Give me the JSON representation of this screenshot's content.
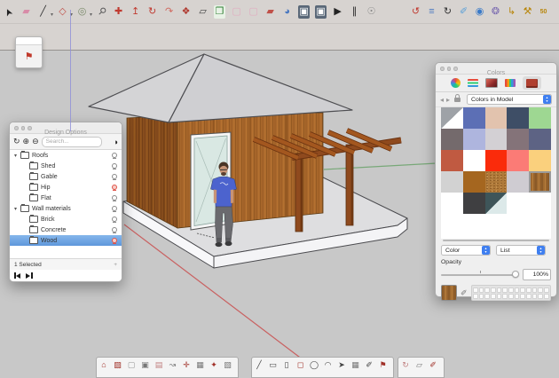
{
  "top_toolbar": {
    "icons_left": [
      {
        "n": "select",
        "g": "➤",
        "c": "#222222",
        "r": -115
      },
      {
        "n": "eraser",
        "g": "▰",
        "c": "#D88CA8"
      },
      {
        "n": "line",
        "g": "╱",
        "c": "#333333",
        "sub": true
      },
      {
        "n": "shape",
        "g": "◇",
        "c": "#C05048",
        "sub": true
      },
      {
        "n": "circle",
        "g": "◎",
        "c": "#7A8A6A",
        "sub": true
      },
      {
        "n": "zoom",
        "g": "⚲",
        "c": "#555555",
        "r": 45
      },
      {
        "n": "move",
        "g": "✚",
        "c": "#C03A30"
      },
      {
        "n": "push-pull",
        "g": "↥",
        "c": "#C03A30"
      },
      {
        "n": "rotate",
        "g": "↻",
        "c": "#C03A30"
      },
      {
        "n": "offset",
        "g": "↷",
        "c": "#D06A60"
      },
      {
        "n": "follow-me",
        "g": "❖",
        "c": "#B03A30"
      },
      {
        "n": "eraser-soft",
        "g": "▱",
        "c": "#444444"
      },
      {
        "n": "make-component",
        "g": "❐",
        "c": "#2E7D32",
        "bg": "#E8F2E6"
      },
      {
        "n": "paint-bucket",
        "g": "▢",
        "c": "#E0AEC0"
      },
      {
        "n": "texture",
        "g": "▢",
        "c": "#E0AEC0"
      },
      {
        "n": "section-plane",
        "g": "▰",
        "c": "#C05048"
      },
      {
        "n": "orbit",
        "g": "◕",
        "c": "#4A78C0"
      },
      {
        "n": "pan",
        "g": "▣",
        "c": "#FFFFFF",
        "bg": "#5A6878"
      },
      {
        "n": "zoom-extents",
        "g": "▣",
        "c": "#FFFFFF",
        "bg": "#5A6878"
      },
      {
        "n": "play",
        "g": "▶",
        "c": "#222222"
      },
      {
        "n": "pause",
        "g": "∥",
        "c": "#222222"
      },
      {
        "n": "user-account",
        "g": "☉",
        "c": "#888888"
      }
    ],
    "icons_right": [
      {
        "n": "redo-history",
        "g": "↺",
        "c": "#C03A30"
      },
      {
        "n": "entity-list",
        "g": "≡",
        "c": "#4A78C0"
      },
      {
        "n": "sync",
        "g": "↻",
        "c": "#333333"
      },
      {
        "n": "style-brush",
        "g": "✐",
        "c": "#5AA0D8"
      },
      {
        "n": "visibility-eye",
        "g": "◉",
        "c": "#3A7AC8"
      },
      {
        "n": "orbit-model",
        "g": "❂",
        "c": "#7A6AB0"
      },
      {
        "n": "pipe-tool",
        "g": "↳",
        "c": "#B8860B"
      },
      {
        "n": "hammer-tool",
        "g": "⚒",
        "c": "#B8860B"
      },
      {
        "n": "fifty-fifty",
        "g": "50",
        "c": "#B8860B",
        "txt": true
      }
    ]
  },
  "mini_palette": {
    "icon_glyph": "⚑"
  },
  "design_options": {
    "title": "Design Options",
    "search_placeholder": "Search...",
    "icons": {
      "refresh": "↻",
      "add": "⊕",
      "remove": "⊖",
      "toggle": "◑"
    },
    "tree": [
      {
        "label": "Roofs"
      },
      {
        "label": "Shed"
      },
      {
        "label": "Gable"
      },
      {
        "label": "Hip"
      },
      {
        "label": "Flat"
      },
      {
        "label": "Wall materials"
      },
      {
        "label": "Brick"
      },
      {
        "label": "Concrete"
      },
      {
        "label": "Wood"
      }
    ],
    "status": "1 Selected",
    "plus": "+"
  },
  "colors_panel": {
    "title": "Colors",
    "nav": {
      "back": "◂",
      "forward": "▸"
    },
    "dropdown_value": "Colors in Model",
    "color_label": "Color",
    "list_label": "List",
    "opacity_label": "Opacity",
    "opacity_value": "100%",
    "swatches": [
      {
        "t": "default"
      },
      {
        "c": "#5C6FB5"
      },
      {
        "c": "#E2C3AE"
      },
      {
        "c": "#3E4E66"
      },
      {
        "c": "#9ED792"
      },
      {
        "c": "#746A6C"
      },
      {
        "c": "#AEB5DE"
      },
      {
        "c": "#D3D0D4"
      },
      {
        "c": "#847379"
      },
      {
        "c": "#5D6384"
      },
      {
        "c": "#C05A41"
      },
      {
        "c": "#FFFFFF"
      },
      {
        "c": "#FA2B0B"
      },
      {
        "c": "#FB7B76"
      },
      {
        "c": "#FAD07D"
      },
      {
        "c": "#D2D2D2"
      },
      {
        "c": "#A5661F"
      },
      {
        "t": "cork"
      },
      {
        "c": "#CFCCD2"
      },
      {
        "t": "wood",
        "sel": true
      },
      {
        "t": "empty"
      },
      {
        "c": "#3F3F41"
      },
      {
        "t": "teal"
      },
      {
        "t": "empty"
      },
      {
        "t": "empty"
      }
    ],
    "well_count": 26,
    "accent_blue": "#3F7FF0"
  },
  "bottom_toolbar": {
    "groups": [
      [
        {
          "g": "⌂",
          "c": "#A03028"
        },
        {
          "g": "▨",
          "c": "#A03028"
        },
        {
          "g": "▢",
          "c": "#999999"
        },
        {
          "g": "▣",
          "c": "#777777"
        },
        {
          "g": "▤",
          "c": "#C08080"
        },
        {
          "g": "↝",
          "c": "#777777"
        },
        {
          "g": "✛",
          "c": "#A03028"
        },
        {
          "g": "▦",
          "c": "#777777"
        },
        {
          "g": "✦",
          "c": "#A03028"
        },
        {
          "g": "▧",
          "c": "#777777"
        }
      ],
      [
        {
          "g": "╱",
          "c": "#444444"
        },
        {
          "g": "▭",
          "c": "#444444"
        },
        {
          "g": "▯",
          "c": "#444444"
        },
        {
          "g": "◻",
          "c": "#A03028"
        },
        {
          "g": "◯",
          "c": "#444444"
        },
        {
          "g": "◠",
          "c": "#444444"
        },
        {
          "g": "➤",
          "c": "#444444"
        },
        {
          "g": "▦",
          "c": "#777777"
        },
        {
          "g": "✐",
          "c": "#444444"
        },
        {
          "g": "⚑",
          "c": "#A03028"
        }
      ],
      [
        {
          "g": "↻",
          "c": "#C08080"
        },
        {
          "g": "▱",
          "c": "#777777"
        },
        {
          "g": "✐",
          "c": "#A03028"
        }
      ]
    ]
  },
  "scene": {
    "viewport_bg": "#C8C8C8",
    "roof_left": "#D4D4D6",
    "roof_right": "#CFCFD2",
    "outline": "#4E4E52",
    "wall_front": "#A9682C",
    "wall_left": "#8A4F1E",
    "slab_top": "#DEDEE0",
    "slab_front_left": "#F8F8FA",
    "slab_front_right": "#F4F4F6",
    "door_frame": "#F6F6F6",
    "door_glass": "#D9E8E3",
    "pergola": "#A3571F",
    "pergola_dark": "#6A3210",
    "post": "#8F4A1E",
    "skin": "#C79476",
    "hair": "#4A3526",
    "shirt": "#4C63CE",
    "pants": "#6A6A6E",
    "shoes": "#3A3A3C",
    "axis_red": "#C96060",
    "axis_green": "#78A878"
  }
}
